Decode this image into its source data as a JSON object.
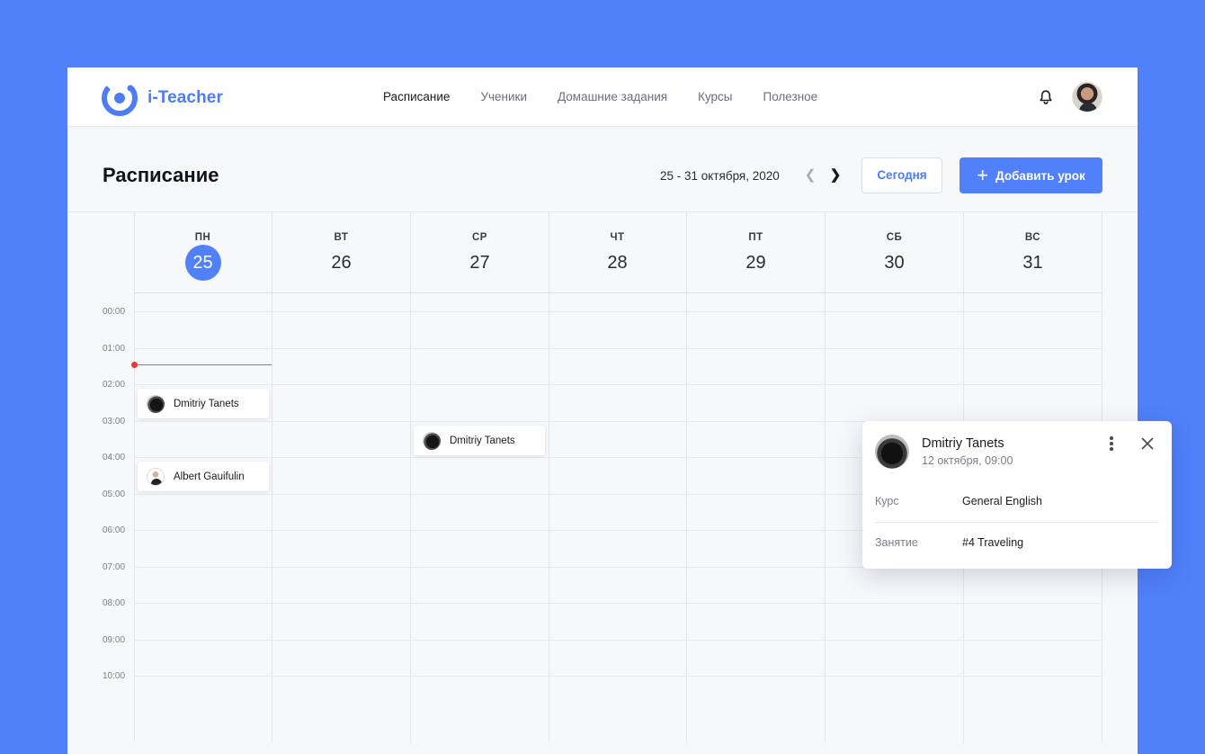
{
  "app": {
    "brand": "i-Teacher",
    "brand_color": "#4d7cf7",
    "accent_color": "#5080fa",
    "background_color": "#5080fa"
  },
  "nav": {
    "items": [
      {
        "label": "Расписание",
        "active": true
      },
      {
        "label": "Ученики",
        "active": false
      },
      {
        "label": "Домашние задания",
        "active": false
      },
      {
        "label": "Курсы",
        "active": false
      },
      {
        "label": "Полезное",
        "active": false
      }
    ],
    "icons": [
      "bell-icon",
      "user-avatar"
    ]
  },
  "toolbar": {
    "title": "Расписание",
    "date_range": "25 - 31 октября, 2020",
    "prev_icon": "chevron-left-icon",
    "next_icon": "chevron-right-icon",
    "today_label": "Сегодня",
    "add_label": "Добавить урок"
  },
  "calendar": {
    "days": [
      {
        "name": "ПН",
        "num": "25",
        "today": true
      },
      {
        "name": "ВТ",
        "num": "26",
        "today": false
      },
      {
        "name": "СР",
        "num": "27",
        "today": false
      },
      {
        "name": "ЧТ",
        "num": "28",
        "today": false
      },
      {
        "name": "ПТ",
        "num": "29",
        "today": false
      },
      {
        "name": "СБ",
        "num": "30",
        "today": false
      },
      {
        "name": "ВС",
        "num": "31",
        "today": false
      }
    ],
    "times": [
      "00:00",
      "01:00",
      "02:00",
      "03:00",
      "04:00",
      "05:00",
      "06:00",
      "07:00",
      "08:00",
      "09:00",
      "10:00"
    ],
    "events": [
      {
        "name": "Dmitriy Tanets",
        "day": "ПН",
        "start": "02:00",
        "avatar": "cat-avatar"
      },
      {
        "name": "Dmitriy Tanets",
        "day": "СР",
        "start": "03:00",
        "avatar": "cat-avatar"
      },
      {
        "name": "Albert Gauifulin",
        "day": "ПН",
        "start": "04:00",
        "avatar": "man-avatar"
      }
    ],
    "now_indicator_color": "#e03a36"
  },
  "popover": {
    "name": "Dmitriy Tanets",
    "date": "12 октября, 09:00",
    "rows": [
      {
        "label": "Курс",
        "value": "General English"
      },
      {
        "label": "Занятие",
        "value": "#4 Traveling"
      }
    ],
    "icons": [
      "more-vertical-icon",
      "close-icon"
    ]
  }
}
